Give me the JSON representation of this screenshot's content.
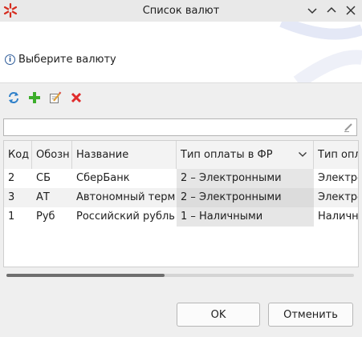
{
  "window": {
    "title": "Список валют",
    "controls": [
      "chevron-down-icon",
      "chevron-up-icon",
      "close-icon"
    ]
  },
  "header": {
    "message": "Выберите валюту",
    "icon": "info-icon"
  },
  "toolbar": {
    "icons": [
      "refresh-icon",
      "add-icon",
      "edit-icon",
      "delete-icon"
    ]
  },
  "filter": {
    "value": "",
    "placeholder": ""
  },
  "table": {
    "columns": [
      "Код",
      "Обозн",
      "Название",
      "Тип оплаты в ФР",
      "Тип опла"
    ],
    "rows": [
      [
        "2",
        "СБ",
        "СберБанк",
        "2 – Электронными",
        "Электро"
      ],
      [
        "3",
        "АТ",
        "Автономный терм",
        "2 – Электронными",
        "Электро"
      ],
      [
        "1",
        "Руб",
        "Российский рубль",
        "1 – Наличными",
        "Наличн"
      ]
    ]
  },
  "buttons": {
    "ok": "OK",
    "cancel": "Отменить"
  },
  "colors": {
    "accent_red": "#d52b1e",
    "info_blue": "#2c5a98",
    "add_green": "#3cae2b"
  }
}
